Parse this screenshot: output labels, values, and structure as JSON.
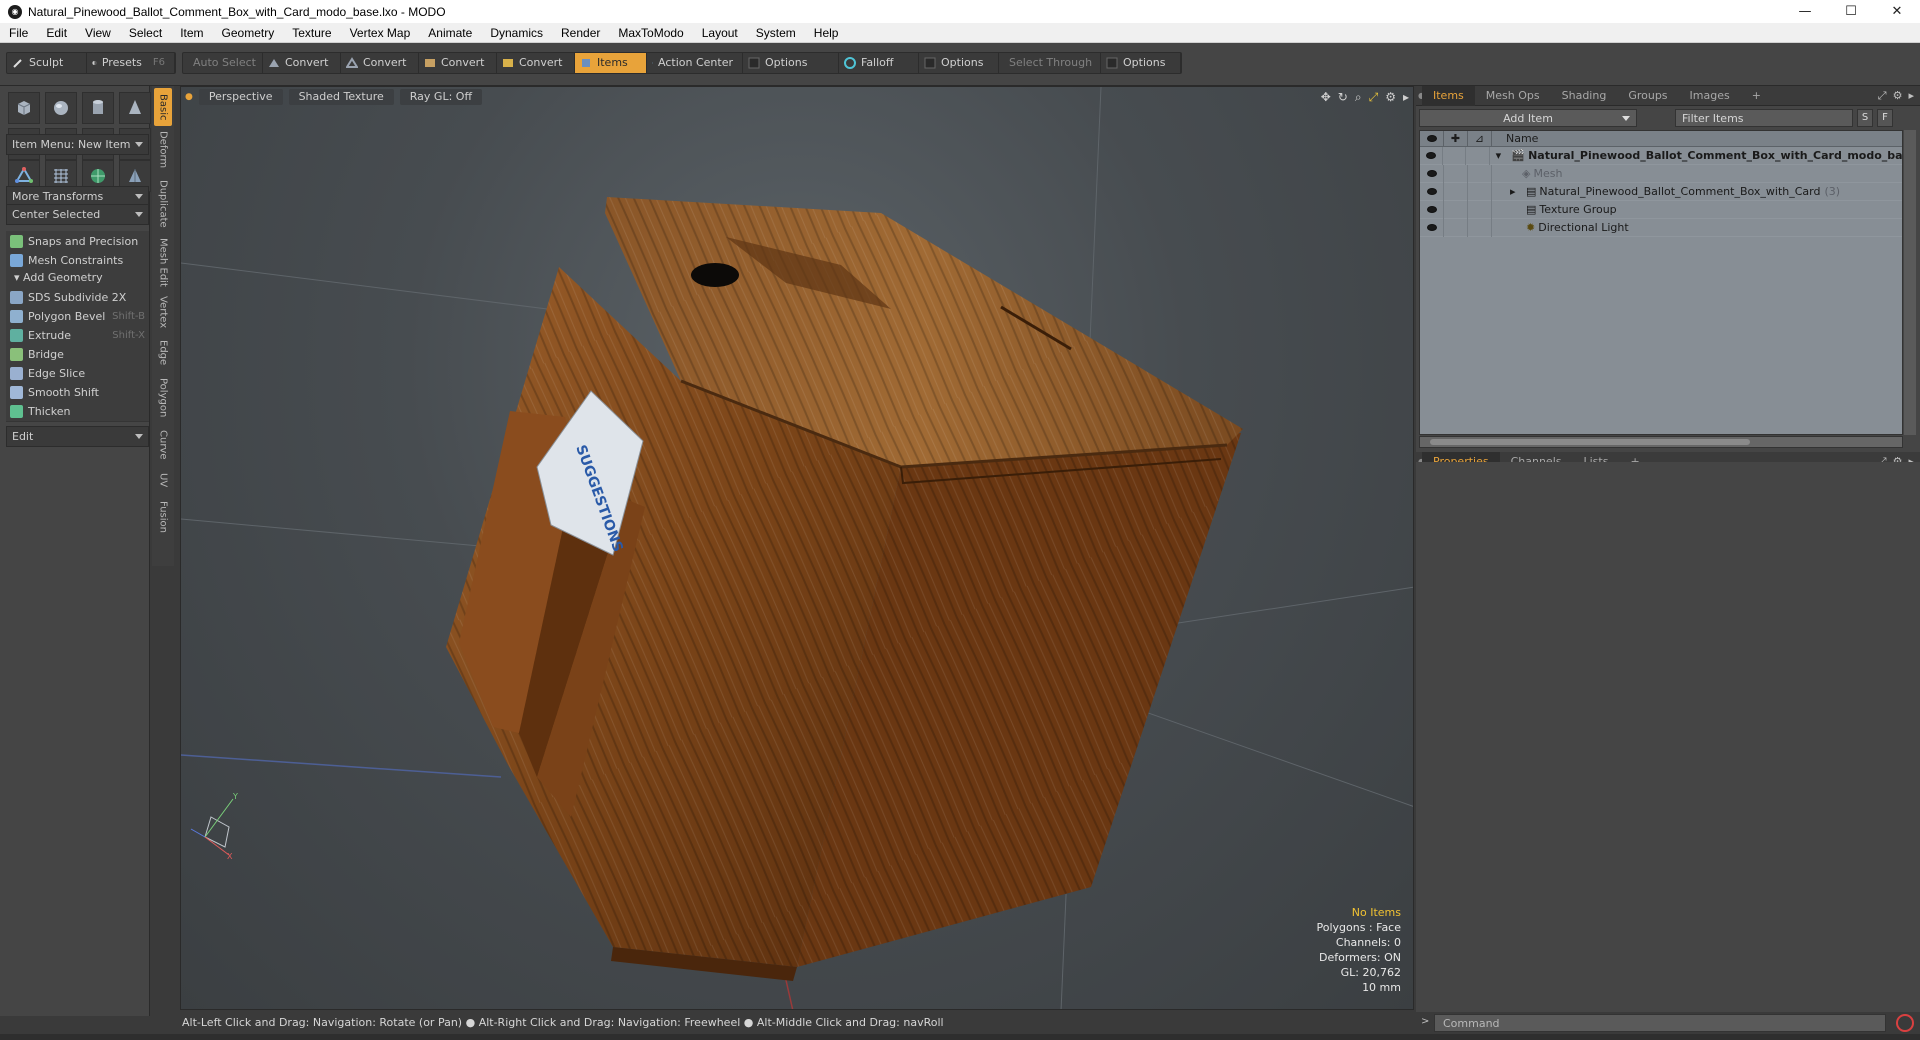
{
  "window": {
    "title": "Natural_Pinewood_Ballot_Comment_Box_with_Card_modo_base.lxo - MODO",
    "icon": "modo-app-icon",
    "controls": {
      "minimize": "—",
      "maximize": "☐",
      "close": "✕"
    }
  },
  "menubar": [
    "File",
    "Edit",
    "View",
    "Select",
    "Item",
    "Geometry",
    "Texture",
    "Vertex Map",
    "Animate",
    "Dynamics",
    "Render",
    "MaxToModo",
    "Layout",
    "System",
    "Help"
  ],
  "toolbar": {
    "sculpt": "Sculpt",
    "presets": "Presets",
    "presets_key": "F6",
    "auto_select": "Auto Select",
    "convert1": "Convert",
    "convert2": "Convert",
    "convert3": "Convert",
    "convert4": "Convert",
    "items": "Items",
    "action_center": "Action Center",
    "options1": "Options",
    "falloff": "Falloff",
    "options2": "Options",
    "select_through": "Select Through",
    "options3": "Options"
  },
  "left_panel": {
    "item_menu": "Item Menu: New Item",
    "more_transforms": "More Transforms",
    "center_selected": "Center Selected",
    "snaps": "Snaps and Precision",
    "mesh_constraints": "Mesh Constraints",
    "add_geometry": "Add Geometry",
    "tools": [
      {
        "label": "SDS Subdivide 2X",
        "shortcut": ""
      },
      {
        "label": "Polygon Bevel",
        "shortcut": "Shift-B"
      },
      {
        "label": "Extrude",
        "shortcut": "Shift-X"
      },
      {
        "label": "Bridge",
        "shortcut": ""
      },
      {
        "label": "Edge Slice",
        "shortcut": ""
      },
      {
        "label": "Smooth Shift",
        "shortcut": ""
      },
      {
        "label": "Thicken",
        "shortcut": ""
      }
    ],
    "edit": "Edit"
  },
  "vertical_tabs": [
    "Basic",
    "Deform",
    "Duplicate",
    "Mesh Edit",
    "Vertex",
    "Edge",
    "Polygon",
    "Curve",
    "UV",
    "Fusion"
  ],
  "viewport": {
    "view": "Perspective",
    "shading": "Shaded Texture",
    "raygl": "Ray GL: Off",
    "info": {
      "items": "No Items",
      "polygons": "Polygons : Face",
      "channels": "Channels: 0",
      "deformers": "Deformers: ON",
      "gl": "GL: 20,762",
      "scale": "10 mm"
    },
    "card_text": "SUGGESTIONS"
  },
  "status_bar": "Alt-Left Click and Drag: Navigation: Rotate (or Pan) ● Alt-Right Click and Drag: Navigation: Freewheel ● Alt-Middle Click and Drag: navRoll",
  "right_panel": {
    "tabs": [
      "Items",
      "Mesh Ops",
      "Shading",
      "Groups",
      "Images"
    ],
    "add_tab": "+",
    "add_item": "Add Item",
    "filter_items": "Filter Items",
    "s_btn": "S",
    "f_btn": "F",
    "name_col": "Name",
    "tree": [
      {
        "label": "Natural_Pinewood_Ballot_Comment_Box_with_Card_modo_ba...",
        "count": ""
      },
      {
        "label": "Mesh",
        "count": ""
      },
      {
        "label": "Natural_Pinewood_Ballot_Comment_Box_with_Card",
        "count": "(3)"
      },
      {
        "label": "Texture Group",
        "count": ""
      },
      {
        "label": "Directional Light",
        "count": ""
      }
    ],
    "props_tabs": [
      "Properties",
      "Channels",
      "Lists"
    ]
  },
  "command": {
    "placeholder": "Command"
  },
  "colors": {
    "accent": "#e8a33a",
    "viewport_bg": "#474c50",
    "panel": "#454545",
    "tree_bg": "#878e95"
  }
}
